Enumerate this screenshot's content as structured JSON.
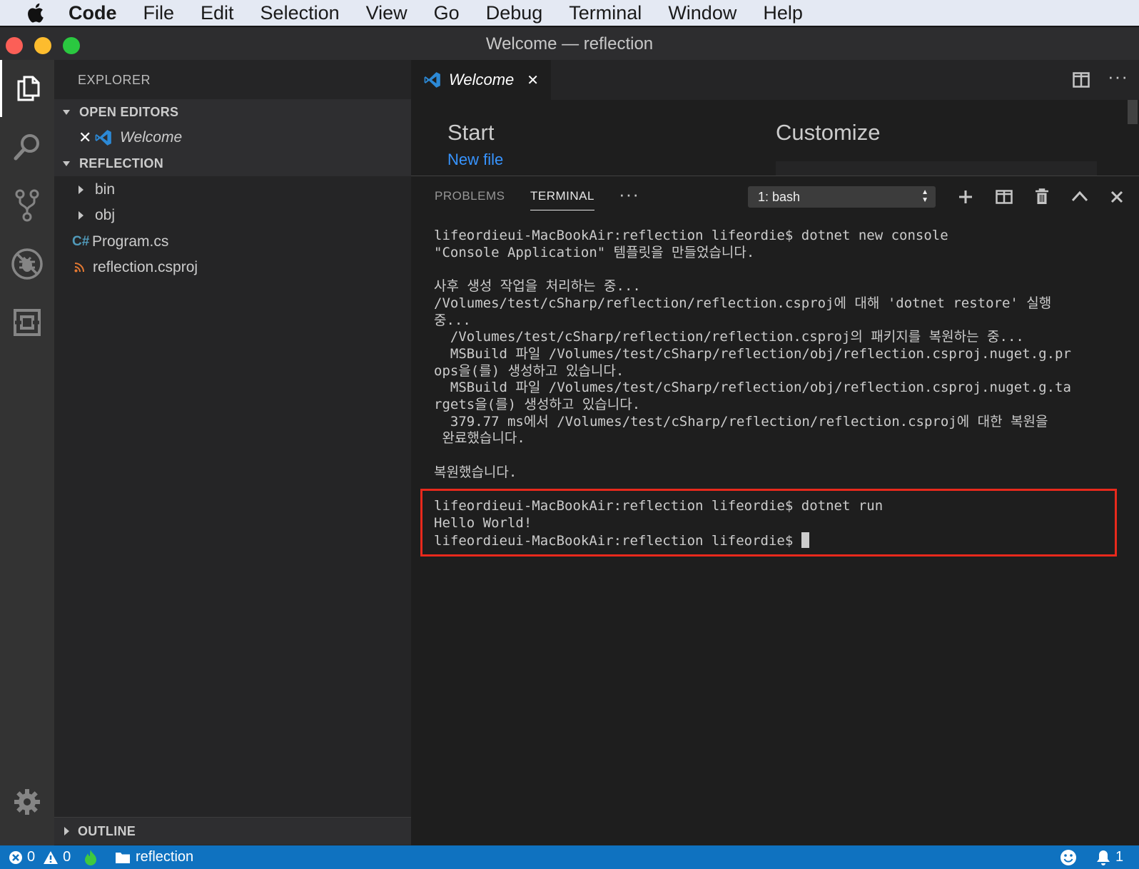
{
  "menubar": {
    "app": "Code",
    "items": [
      "File",
      "Edit",
      "Selection",
      "View",
      "Go",
      "Debug",
      "Terminal",
      "Window",
      "Help"
    ]
  },
  "window": {
    "title": "Welcome — reflection"
  },
  "sidebar": {
    "title": "EXPLORER",
    "open_editors": {
      "label": "OPEN EDITORS",
      "items": [
        {
          "label": "Welcome"
        }
      ]
    },
    "folder": {
      "label": "REFLECTION",
      "items": [
        {
          "label": "bin",
          "icon": "chevron-right-icon"
        },
        {
          "label": "obj",
          "icon": "chevron-right-icon"
        },
        {
          "label": "Program.cs",
          "icon": "csharp-file-icon"
        },
        {
          "label": "reflection.csproj",
          "icon": "rss-file-icon"
        }
      ]
    },
    "outline": {
      "label": "OUTLINE"
    }
  },
  "editor": {
    "tab": {
      "label": "Welcome"
    },
    "welcome": {
      "start": "Start",
      "new_file": "New file",
      "customize": "Customize"
    }
  },
  "panel": {
    "tabs": [
      "PROBLEMS",
      "TERMINAL"
    ],
    "terminal_select": "1: bash",
    "output_lines": [
      "lifeordieui-MacBookAir:reflection lifeordie$ dotnet new console",
      "\"Console Application\" 템플릿을 만들었습니다.",
      "",
      "사후 생성 작업을 처리하는 중...",
      "/Volumes/test/cSharp/reflection/reflection.csproj에 대해 'dotnet restore' 실행",
      "중...",
      "  /Volumes/test/cSharp/reflection/reflection.csproj의 패키지를 복원하는 중...",
      "  MSBuild 파일 /Volumes/test/cSharp/reflection/obj/reflection.csproj.nuget.g.pr",
      "ops을(를) 생성하고 있습니다.",
      "  MSBuild 파일 /Volumes/test/cSharp/reflection/obj/reflection.csproj.nuget.g.ta",
      "rgets을(를) 생성하고 있습니다.",
      "  379.77 ms에서 /Volumes/test/cSharp/reflection/reflection.csproj에 대한 복원을",
      " 완료했습니다.",
      "",
      "복원했습니다.",
      ""
    ],
    "highlight_lines": [
      "lifeordieui-MacBookAir:reflection lifeordie$ dotnet run",
      "Hello World!",
      "lifeordieui-MacBookAir:reflection lifeordie$ "
    ]
  },
  "statusbar": {
    "errors": "0",
    "warnings": "0",
    "folder": "reflection",
    "notifications": "1"
  },
  "colors": {
    "accent": "#0f72c0",
    "highlight_box": "#e8291c",
    "link": "#3794ff"
  }
}
